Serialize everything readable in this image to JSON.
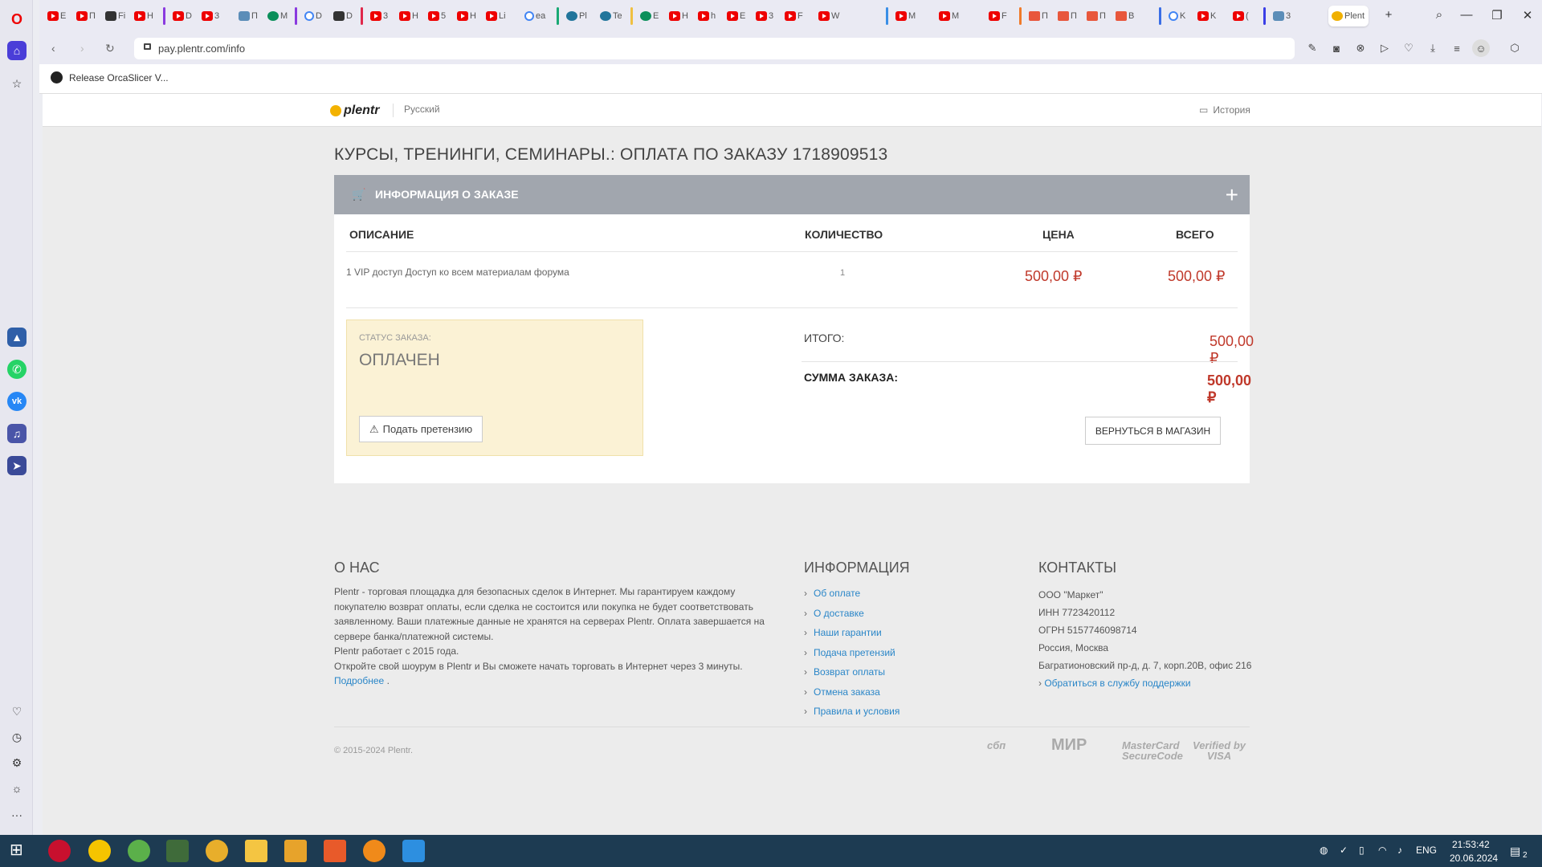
{
  "browser": {
    "tabs": [
      "E",
      "П",
      "Fi",
      "H",
      "D",
      "3",
      "П",
      "M",
      "D",
      "D",
      "3",
      "H",
      "5",
      "H",
      "Li",
      "ea",
      "Pl",
      "Te",
      "E",
      "H",
      "h",
      "E",
      "3",
      "F",
      "W",
      "M",
      "M",
      "F",
      "П",
      "П",
      "П",
      "B",
      "K",
      "K",
      "(",
      "3",
      "Plent"
    ],
    "active_tab": "Plent",
    "url": "pay.plentr.com/info",
    "bookmark": "Release OrcaSlicer V..."
  },
  "site": {
    "logo": "plentr",
    "language": "Русский",
    "history": "История"
  },
  "order": {
    "title": "КУРСЫ, ТРЕНИНГИ, СЕМИНАРЫ.: ОПЛАТА ПО ЗАКАЗУ 1718909513",
    "card_title": "ИНФОРМАЦИЯ О ЗАКАЗЕ",
    "columns": {
      "description": "ОПИСАНИЕ",
      "quantity": "КОЛИЧЕСТВО",
      "price": "ЦЕНА",
      "total": "ВСЕГО"
    },
    "items": [
      {
        "description": "1 VIP доступ Доступ ко всем материалам форума",
        "quantity": "1",
        "price": "500,00 ₽",
        "total": "500,00 ₽"
      }
    ],
    "status_label": "СТАТУС ЗАКАЗА:",
    "status_value": "ОПЛАЧЕН",
    "claim_button": "Подать претензию",
    "subtotal_label": "ИТОГО:",
    "subtotal_value": "500,00 ₽",
    "sum_label": "СУММА ЗАКАЗА:",
    "sum_value": "500,00 ₽",
    "back_button": "ВЕРНУТЬСЯ В МАГАЗИН"
  },
  "footer": {
    "about_title": "О НАС",
    "about_text1": "Plentr - торговая площадка для безопасных сделок в Интернет. Мы гарантируем каждому покупателю возврат оплаты, если сделка не состоится или покупка не будет соответствовать заявленному. Ваши платежные данные не хранятся на серверах Plentr. Оплата завершается на сервере банка/платежной системы.",
    "about_text2": "Plentr работает с 2015 года.",
    "about_text3": "Откройте свой шоурум в Plentr и Вы сможете начать торговать в Интернет через 3 минуты.",
    "about_more": "Подробнее",
    "info_title": "ИНФОРМАЦИЯ",
    "info_links": [
      "Об оплате",
      "О доставке",
      "Наши гарантии",
      "Подача претензий",
      "Возврат оплаты",
      "Отмена заказа",
      "Правила и условия"
    ],
    "contacts_title": "КОНТАКТЫ",
    "contacts": [
      "ООО \"Маркет\"",
      "ИНН 7723420112",
      "ОГРН 5157746098714",
      "Россия, Москва",
      "Багратионовский пр-д, д. 7, корп.20В, офис 216"
    ],
    "support_link": "Обратиться в службу поддержки",
    "copyright": "© 2015-2024 Plentr.",
    "payments": [
      "сбп",
      "МИР",
      "MasterCard SecureCode",
      "Verified by VISA"
    ]
  },
  "taskbar": {
    "lang": "ENG",
    "time": "21:53:42",
    "date": "20.06.2024",
    "notifications": "2"
  }
}
